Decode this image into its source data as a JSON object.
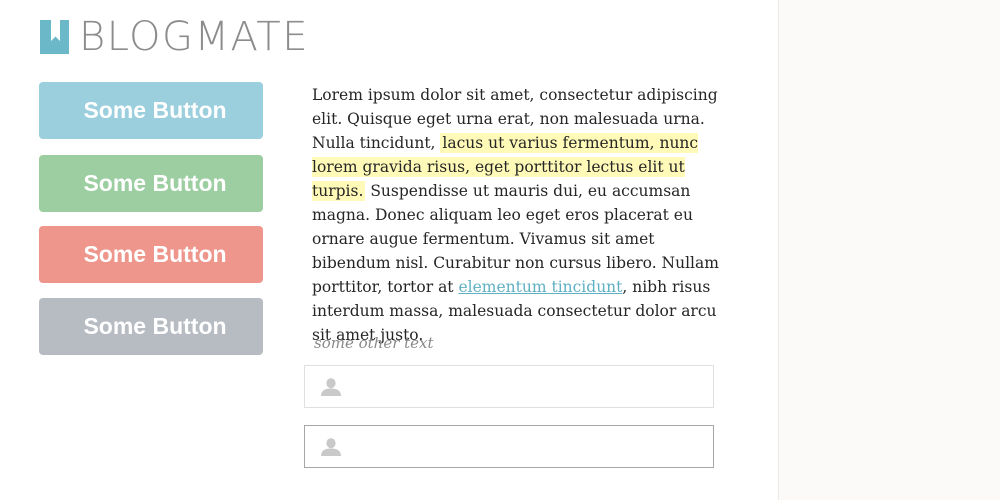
{
  "logo": {
    "text": "BLOGMATE",
    "icon": "bookmark-icon",
    "color": "#6bb8c9"
  },
  "buttons": [
    {
      "label": "Some Button",
      "color": "#9bcfdd"
    },
    {
      "label": "Some Button",
      "color": "#9ccea1"
    },
    {
      "label": "Some Button",
      "color": "#ee968b"
    },
    {
      "label": "Some Button",
      "color": "#b6bcc2"
    }
  ],
  "article": {
    "text_before": "Lorem ipsum dolor sit amet, consectetur adipiscing elit. Quisque eget urna erat, non malesuada urna. Nulla tinc­idunt,",
    "highlight": "lacus ut varius fermentum, nunc lorem gravida risus, eget porttitor lectus elit ut turpis.",
    "text_middle": " Suspendisse ut mauris dui, eu accumsan magna. Donec aliquam leo eget eros placerat eu ornare augue fermentum. Vivamus sit amet bibendum nisl. Curabitur non cursus libero. Nullam porttitor, tortor at ",
    "link": "elementum tincidunt",
    "text_after": ", nibh risus interdum massa, malesuada consectetur dolor arcu sit amet justo.",
    "highlight_color": "#fffab8",
    "link_color": "#5fb0c3"
  },
  "caption": "some other text",
  "fields": [
    {
      "icon": "user-icon",
      "value": "",
      "placeholder": ""
    },
    {
      "icon": "user-icon",
      "value": "",
      "placeholder": ""
    }
  ]
}
